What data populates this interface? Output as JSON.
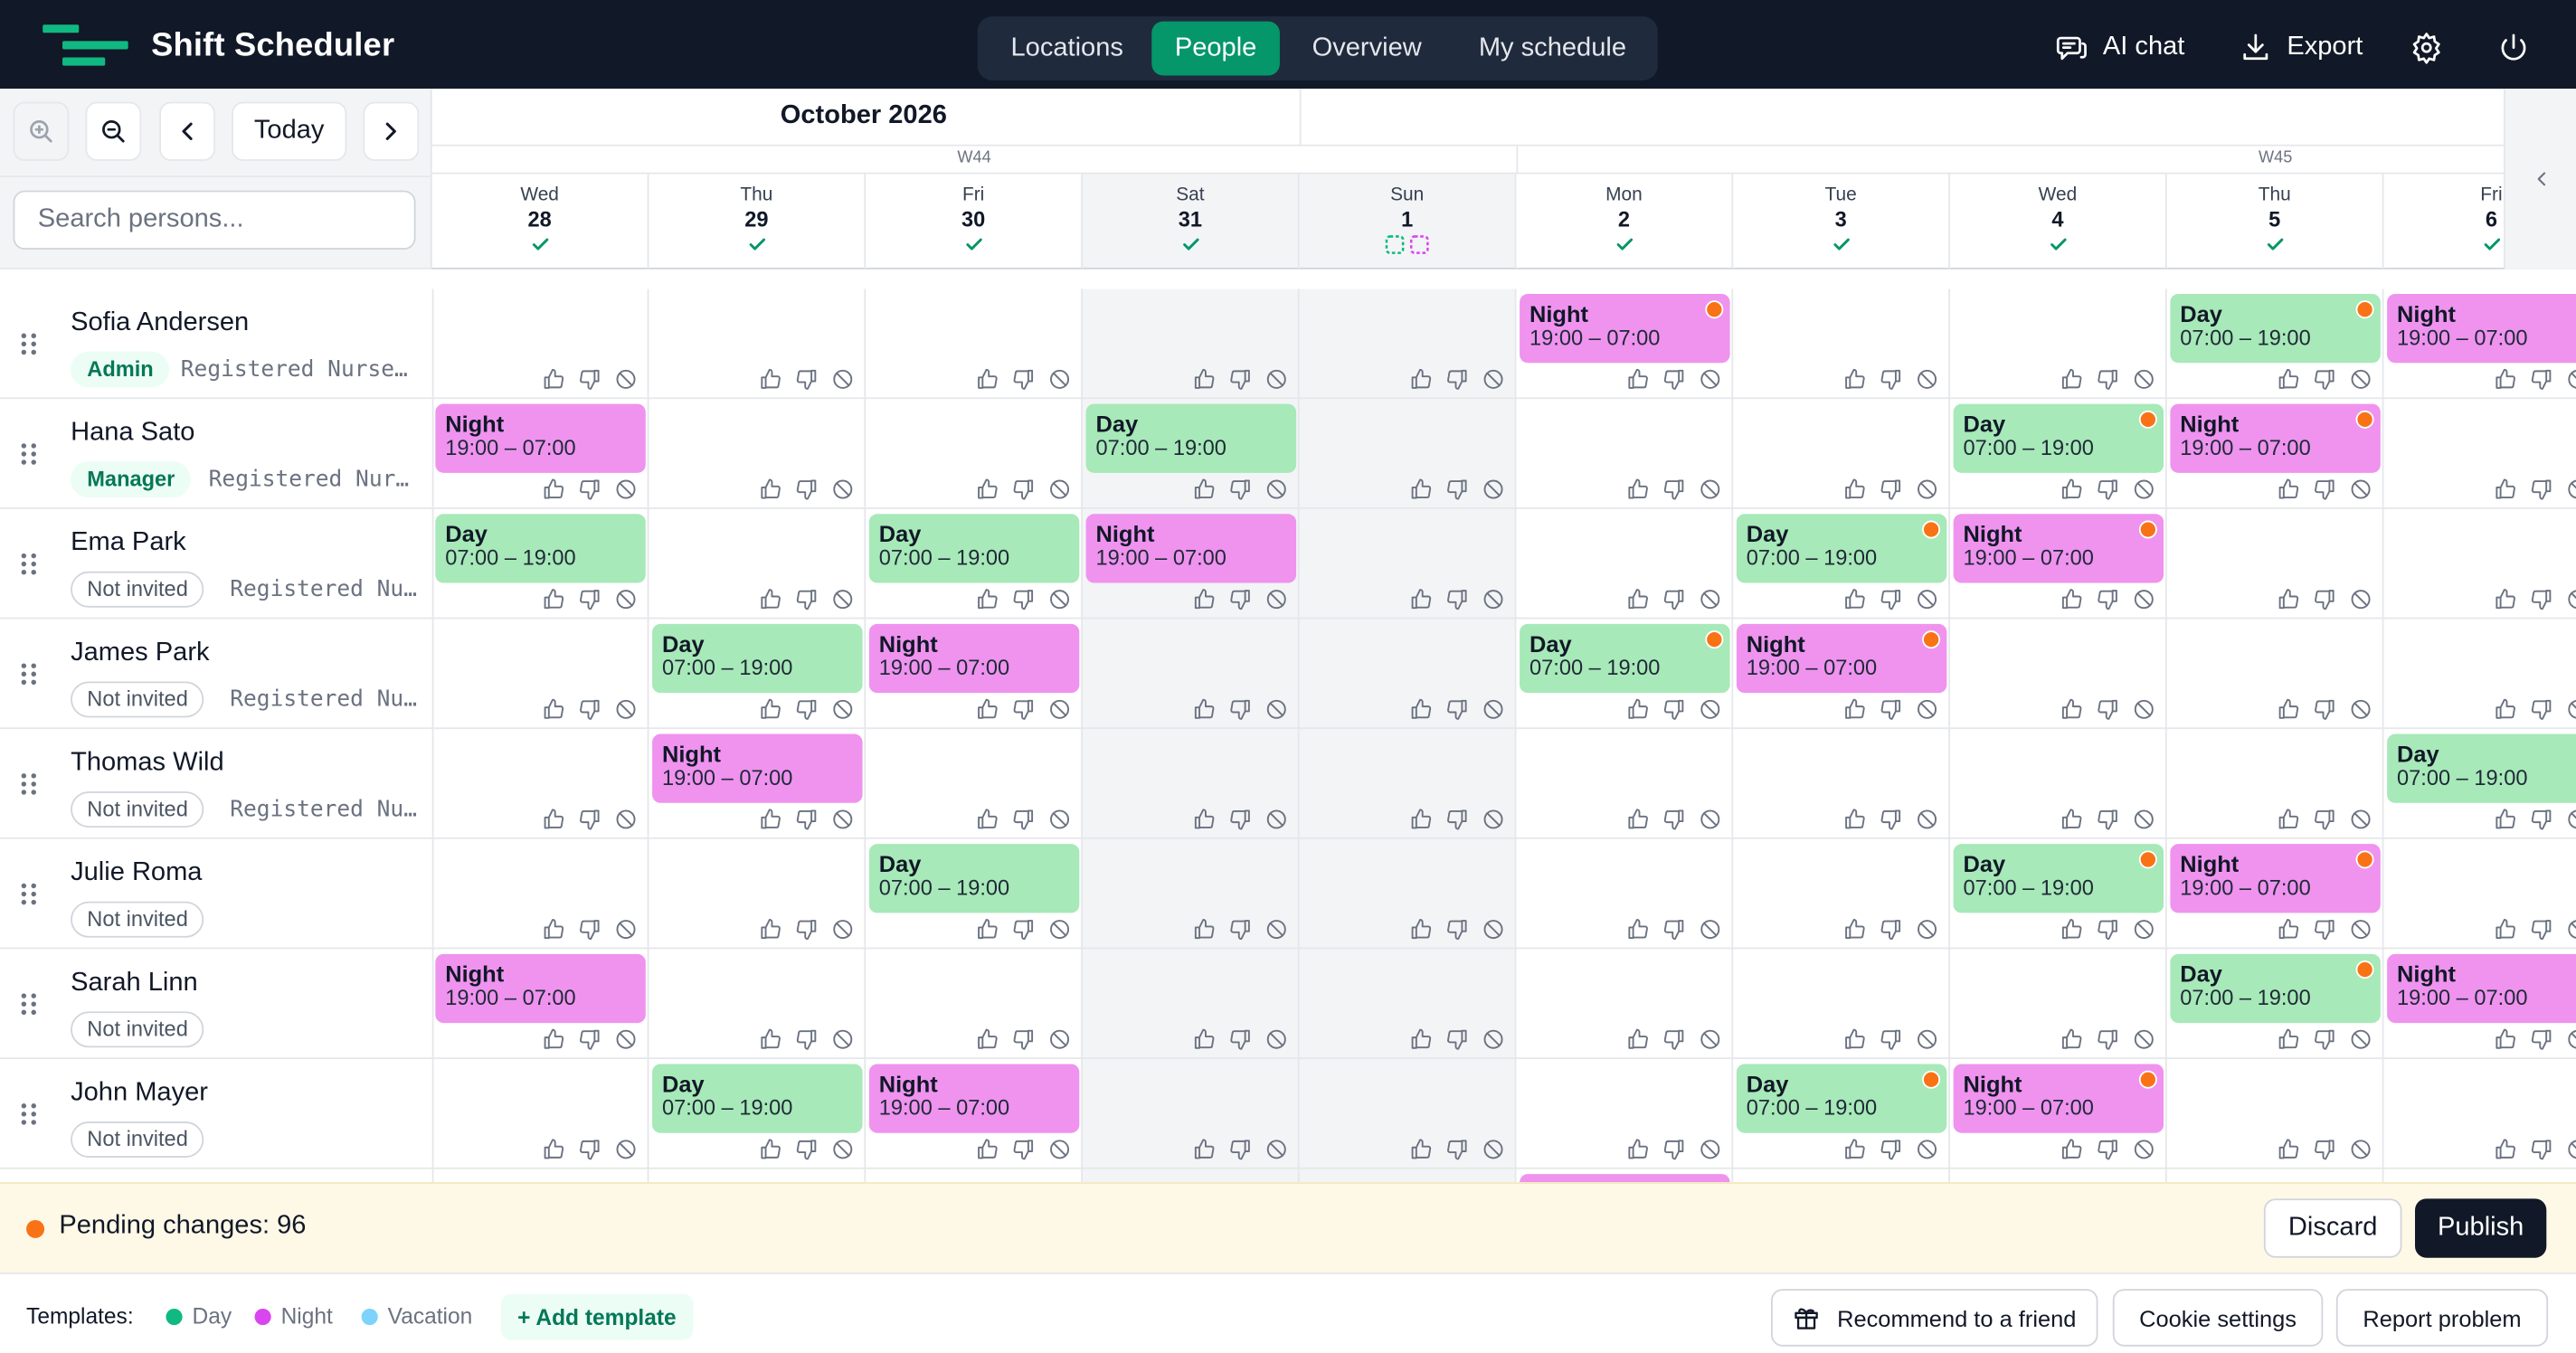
{
  "app": {
    "title": "Shift Scheduler"
  },
  "nav": {
    "tabs": [
      {
        "label": "Locations"
      },
      {
        "label": "People",
        "active": true
      },
      {
        "label": "Overview"
      },
      {
        "label": "My schedule"
      }
    ]
  },
  "topbar": {
    "ai_chat": "AI chat",
    "export": "Export"
  },
  "toolbar": {
    "today": "Today"
  },
  "search": {
    "placeholder": "Search persons..."
  },
  "calendar": {
    "month": "October 2026",
    "weeks": [
      "W44",
      "W45"
    ],
    "days": [
      {
        "name": "Wed",
        "date": "28",
        "status": "check"
      },
      {
        "name": "Thu",
        "date": "29",
        "status": "check"
      },
      {
        "name": "Fri",
        "date": "30",
        "status": "check"
      },
      {
        "name": "Sat",
        "date": "31",
        "status": "check"
      },
      {
        "name": "Sun",
        "date": "1",
        "status": "pending"
      },
      {
        "name": "Mon",
        "date": "2",
        "status": "check"
      },
      {
        "name": "Tue",
        "date": "3",
        "status": "check"
      },
      {
        "name": "Wed",
        "date": "4",
        "status": "check"
      },
      {
        "name": "Thu",
        "date": "5",
        "status": "check"
      },
      {
        "name": "Fri",
        "date": "6",
        "status": "check"
      }
    ]
  },
  "people": [
    {
      "name": "Sofia Andersen",
      "badge": "Admin",
      "role": "Registered Nurse ...",
      "shifts": [
        {
          "day": 5,
          "type": "Night",
          "time": "19:00 – 07:00",
          "changed": true
        },
        {
          "day": 8,
          "type": "Day",
          "time": "07:00 – 19:00",
          "changed": true
        },
        {
          "day": 9,
          "type": "Night",
          "time": "19:00 – 07:00",
          "changed": false
        }
      ]
    },
    {
      "name": "Hana Sato",
      "badge": "Manager",
      "role": "Registered Nurs...",
      "shifts": [
        {
          "day": 0,
          "type": "Night",
          "time": "19:00 – 07:00",
          "changed": false
        },
        {
          "day": 3,
          "type": "Day",
          "time": "07:00 – 19:00",
          "changed": false
        },
        {
          "day": 7,
          "type": "Day",
          "time": "07:00 – 19:00",
          "changed": true
        },
        {
          "day": 8,
          "type": "Night",
          "time": "19:00 – 07:00",
          "changed": true
        }
      ]
    },
    {
      "name": "Ema Park",
      "badge": "Not invited",
      "role": "Registered Nu...",
      "shifts": [
        {
          "day": 0,
          "type": "Day",
          "time": "07:00 – 19:00",
          "changed": false
        },
        {
          "day": 2,
          "type": "Day",
          "time": "07:00 – 19:00",
          "changed": false
        },
        {
          "day": 3,
          "type": "Night",
          "time": "19:00 – 07:00",
          "changed": false
        },
        {
          "day": 6,
          "type": "Day",
          "time": "07:00 – 19:00",
          "changed": true
        },
        {
          "day": 7,
          "type": "Night",
          "time": "19:00 – 07:00",
          "changed": true
        }
      ]
    },
    {
      "name": "James Park",
      "badge": "Not invited",
      "role": "Registered Nu...",
      "shifts": [
        {
          "day": 1,
          "type": "Day",
          "time": "07:00 – 19:00",
          "changed": false
        },
        {
          "day": 2,
          "type": "Night",
          "time": "19:00 – 07:00",
          "changed": false
        },
        {
          "day": 5,
          "type": "Day",
          "time": "07:00 – 19:00",
          "changed": true
        },
        {
          "day": 6,
          "type": "Night",
          "time": "19:00 – 07:00",
          "changed": true
        }
      ]
    },
    {
      "name": "Thomas Wild",
      "badge": "Not invited",
      "role": "Registered Nu...",
      "shifts": [
        {
          "day": 1,
          "type": "Night",
          "time": "19:00 – 07:00",
          "changed": false
        },
        {
          "day": 9,
          "type": "Day",
          "time": "07:00 – 19:00",
          "changed": false
        }
      ]
    },
    {
      "name": "Julie Roma",
      "badge": "Not invited",
      "role": "",
      "shifts": [
        {
          "day": 2,
          "type": "Day",
          "time": "07:00 – 19:00",
          "changed": false
        },
        {
          "day": 7,
          "type": "Day",
          "time": "07:00 – 19:00",
          "changed": true
        },
        {
          "day": 8,
          "type": "Night",
          "time": "19:00 – 07:00",
          "changed": true
        }
      ]
    },
    {
      "name": "Sarah Linn",
      "badge": "Not invited",
      "role": "",
      "shifts": [
        {
          "day": 0,
          "type": "Night",
          "time": "19:00 – 07:00",
          "changed": false
        },
        {
          "day": 8,
          "type": "Day",
          "time": "07:00 – 19:00",
          "changed": true
        },
        {
          "day": 9,
          "type": "Night",
          "time": "19:00 – 07:00",
          "changed": false
        }
      ]
    },
    {
      "name": "John Mayer",
      "badge": "Not invited",
      "role": "",
      "shifts": [
        {
          "day": 1,
          "type": "Day",
          "time": "07:00 – 19:00",
          "changed": false
        },
        {
          "day": 2,
          "type": "Night",
          "time": "19:00 – 07:00",
          "changed": false
        },
        {
          "day": 6,
          "type": "Day",
          "time": "07:00 – 19:00",
          "changed": true
        },
        {
          "day": 7,
          "type": "Night",
          "time": "19:00 – 07:00",
          "changed": true
        }
      ]
    }
  ],
  "pending": {
    "text": "Pending changes: 96",
    "discard": "Discard",
    "publish": "Publish"
  },
  "footer": {
    "templates_label": "Templates:",
    "templates": [
      {
        "label": "Day",
        "color": "#10b981"
      },
      {
        "label": "Night",
        "color": "#d946ef"
      },
      {
        "label": "Vacation",
        "color": "#7dd3fc"
      }
    ],
    "add_template": "+ Add template",
    "recommend": "Recommend to a friend",
    "cookies": "Cookie settings",
    "report": "Report problem"
  },
  "colors": {
    "accent": "#059669",
    "topbar": "#111827",
    "day_shift": "#a7e9b8",
    "night_shift": "#ef93ef",
    "changed_dot": "#f97316"
  }
}
